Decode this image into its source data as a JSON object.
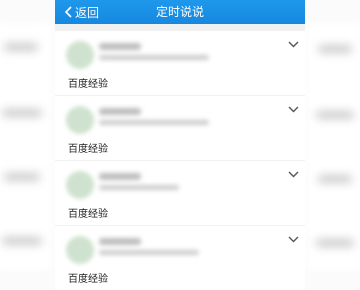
{
  "nav": {
    "back_label": "返回",
    "title": "定时说说"
  },
  "colors": {
    "nav_bar": "#1a8fe6",
    "card": "#ffffff",
    "panel": "#f1f1f1"
  },
  "posts": [
    {
      "content": "百度经验"
    },
    {
      "content": "百度经验"
    },
    {
      "content": "百度经验"
    },
    {
      "content": "百度经验"
    }
  ]
}
